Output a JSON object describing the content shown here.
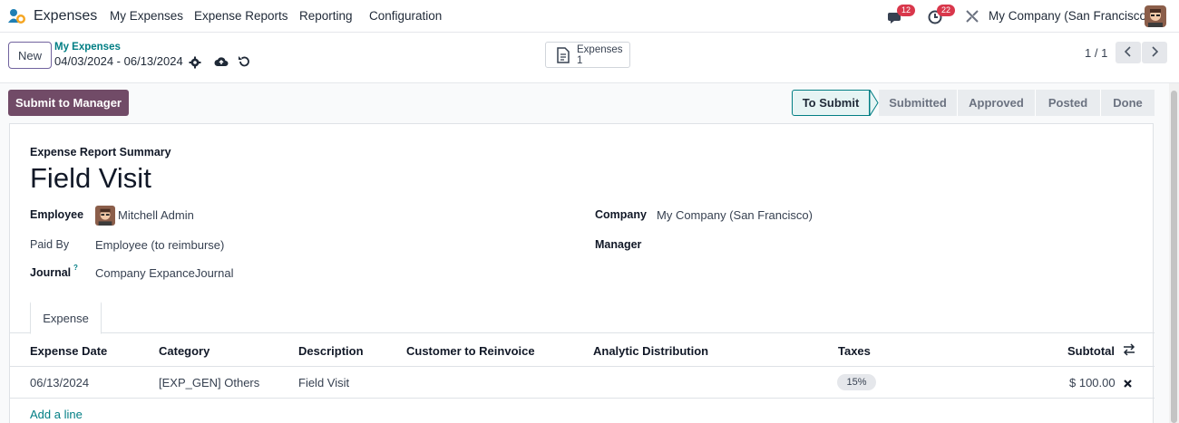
{
  "navbar": {
    "app_name": "Expenses",
    "menus": [
      "My Expenses",
      "Expense Reports",
      "Reporting",
      "Configuration"
    ],
    "messages_count": "12",
    "activities_count": "22",
    "company": "My Company (San Francisco)"
  },
  "control_panel": {
    "new_label": "New",
    "breadcrumb": "My Expenses",
    "record_title": "04/03/2024 - 06/13/2024",
    "smart_button": {
      "label": "Expenses",
      "count": "1"
    },
    "pager": "1 / 1"
  },
  "actions": {
    "submit_label": "Submit to Manager"
  },
  "statusbar": {
    "stages": [
      "To Submit",
      "Submitted",
      "Approved",
      "Posted",
      "Done"
    ],
    "active": "To Submit"
  },
  "form": {
    "summary_label": "Expense Report Summary",
    "title": "Field Visit",
    "employee_label": "Employee",
    "employee_value": "Mitchell Admin",
    "paid_by_label": "Paid By",
    "paid_by_value": "Employee (to reimburse)",
    "journal_label": "Journal",
    "journal_help": "?",
    "journal_value": "Company ExpanceJournal",
    "company_label": "Company",
    "company_value": "My Company (San Francisco)",
    "manager_label": "Manager"
  },
  "tabs": [
    "Expense"
  ],
  "table": {
    "headers": [
      "Expense Date",
      "Category",
      "Description",
      "Customer to Reinvoice",
      "Analytic Distribution",
      "Taxes",
      "Subtotal"
    ],
    "rows": [
      {
        "date": "06/13/2024",
        "category": "[EXP_GEN] Others",
        "description": "Field Visit",
        "customer": "",
        "analytic": "",
        "taxes": "15%",
        "subtotal": "$ 100.00"
      }
    ],
    "add_line": "Add a line"
  },
  "colors": {
    "brand": "#714b67",
    "link": "#017e84",
    "badge": "#d9374b"
  }
}
